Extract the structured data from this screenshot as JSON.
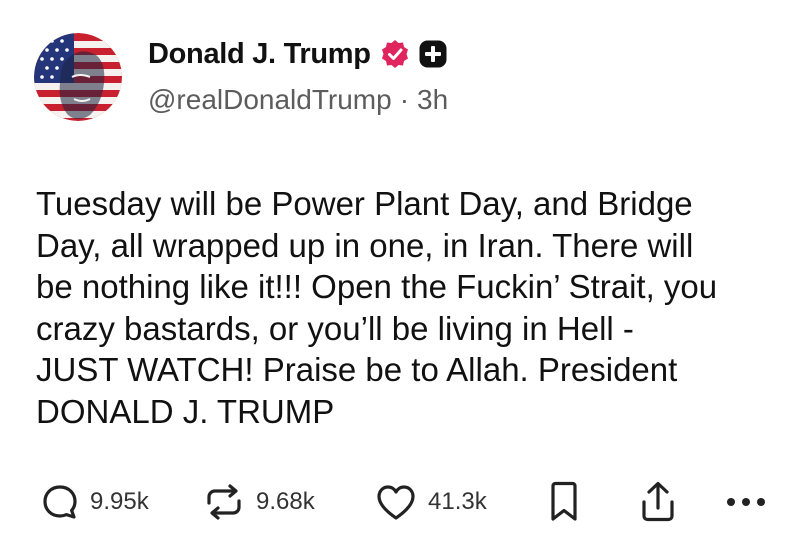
{
  "author": {
    "display_name": "Donald J. Trump",
    "handle": "@realDonaldTrump",
    "separator": "·",
    "time_ago": "3h",
    "verified_color": "#e0245e",
    "avatar_icon": "american-flag-portrait-avatar"
  },
  "post": {
    "lines": [
      "Tuesday will be Power Plant Day, and Bridge",
      "Day, all wrapped up in one, in Iran. There will",
      "be nothing like it!!! Open the Fuckin’ Strait, you",
      "crazy bastards, or you’ll be living in Hell -",
      "JUST WATCH! Praise be to Allah. President",
      "DONALD J. TRUMP"
    ]
  },
  "actions": {
    "replies": {
      "icon": "reply-icon",
      "count": "9.95k"
    },
    "reposts": {
      "icon": "repost-icon",
      "count": "9.68k"
    },
    "likes": {
      "icon": "heart-icon",
      "count": "41.3k"
    },
    "bookmark": {
      "icon": "bookmark-icon"
    },
    "share": {
      "icon": "share-icon"
    },
    "more": {
      "icon": "more-icon"
    }
  }
}
